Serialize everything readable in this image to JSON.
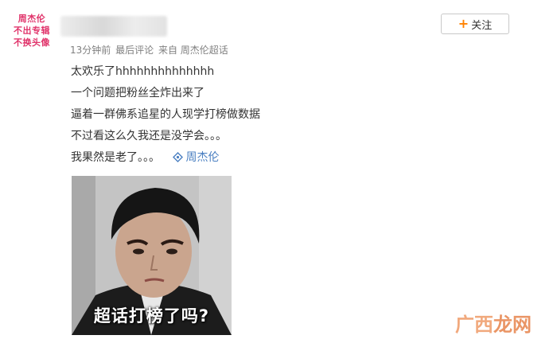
{
  "avatar": {
    "lines": [
      "周杰伦",
      "不出专辑",
      "不换头像"
    ]
  },
  "post": {
    "follow_label": "关注",
    "meta": {
      "time": "13分钟前",
      "last_comment": "最后评论",
      "source": "来自 周杰伦超话"
    },
    "lines": [
      "太欢乐了hhhhhhhhhhhhhh",
      "一个问题把粉丝全炸出来了",
      "逼着一群佛系追星的人现学打榜做数据",
      "不过看这么久我还是没学会。。。",
      "我果然是老了。。。"
    ],
    "topic_link": "周杰伦",
    "image_caption": "超话打榜了吗?"
  },
  "watermark": {
    "part1": "广西",
    "part2": "龙网"
  },
  "colors": {
    "accent": "#ff8200",
    "link": "#4a7fc1",
    "avatar_text": "#e0336a"
  }
}
